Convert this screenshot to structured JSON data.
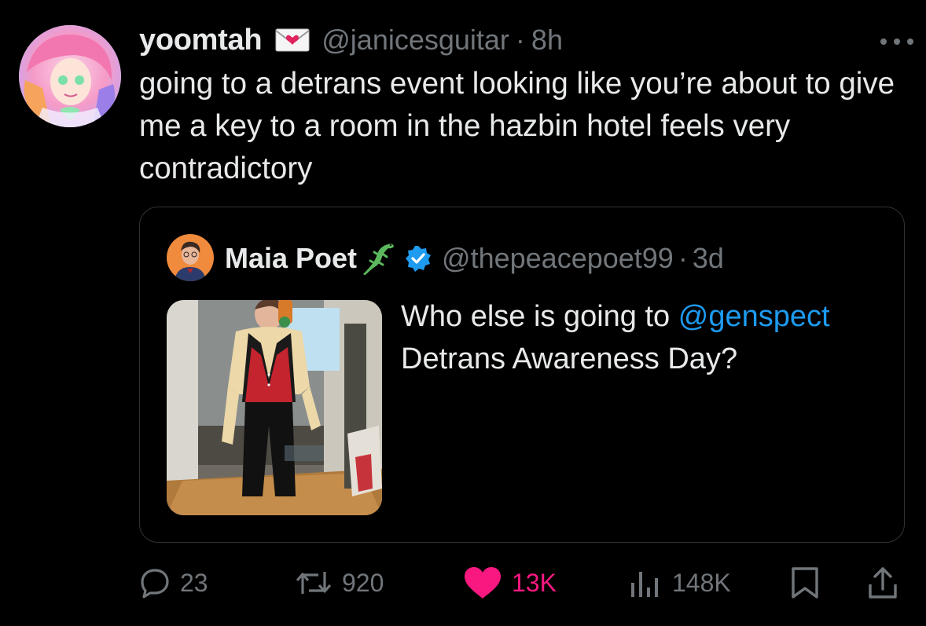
{
  "tweet": {
    "author_name": "yoomtah",
    "author_emoji_icon": "love-letter-icon",
    "handle": "@janicesguitar",
    "separator": "·",
    "time": "8h",
    "more_icon": "more-icon",
    "text": "going to a detrans event looking like you’re about to give me a key to a room in the hazbin hotel feels very contradictory"
  },
  "quoted": {
    "author_name": "Maia Poet",
    "author_emoji_icon": "lizard-icon",
    "verified_icon": "verified-badge-icon",
    "handle": "@thepeacepoet99",
    "separator": "·",
    "time": "3d",
    "text_before": "Who else is going to ",
    "mention": "@genspect",
    "text_after": " Detrans Awareness Day?"
  },
  "actions": {
    "replies": "23",
    "reposts": "920",
    "likes": "13K",
    "views": "148K"
  },
  "colors": {
    "background": "#000000",
    "text": "#e7e9ea",
    "muted": "#71767b",
    "link": "#1d9bf0",
    "like": "#f91880",
    "border": "#2f3336"
  }
}
